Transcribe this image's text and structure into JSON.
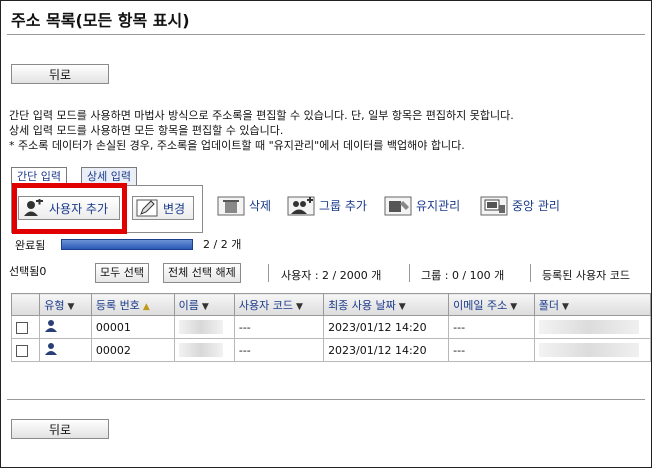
{
  "page": {
    "title": "주소 목록(모든 항목 표시)"
  },
  "nav": {
    "back_label": "뒤로"
  },
  "info": {
    "line1": "간단 입력 모드를 사용하면 마법사 방식으로 주소록을 편집할 수 있습니다. 단, 일부 항목은 편집하지 못합니다.",
    "line2": "상세 입력 모드를 사용하면 모든 항목을 편집할 수 있습니다.",
    "line3": "* 주소록 데이터가 손실된 경우, 주소록을 업데이트할 때 \"유지관리\"에서 데이터를 백업해야 합니다."
  },
  "tabs": [
    {
      "label": "간단 입력"
    },
    {
      "label": "상세 입력"
    }
  ],
  "toolbar": {
    "add_user": "사용자 추가",
    "edit": "변경",
    "delete": "삭제",
    "add_group": "그룹 추가",
    "maintenance": "유지관리",
    "central_management": "중앙 관리"
  },
  "progress": {
    "label": "완료됨",
    "text": "2 / 2 개",
    "fraction": 1.0
  },
  "selection": {
    "selected_label": "선택됨0",
    "select_all": "모두 선택",
    "clear_all": "전체 선택 해제",
    "user_count": "사용자 : 2 / 2000 개",
    "group_count": "그룹 : 0 / 100 개",
    "registered_user_code": "등록된 사용자 코드"
  },
  "table": {
    "headers": [
      "유형",
      "등록 번호",
      "이름",
      "사용자 코드",
      "최종 사용 날짜",
      "이메일 주소",
      "폴더"
    ],
    "rows": [
      {
        "reg_no": "00001",
        "user_code": "---",
        "last_used": "2023/01/12 14:20",
        "email": "---"
      },
      {
        "reg_no": "00002",
        "user_code": "---",
        "last_used": "2023/01/12 14:20",
        "email": "---"
      }
    ]
  },
  "colors": {
    "link": "#1a3a8a",
    "highlight": "#e00000",
    "progress": "#2b5bb8"
  }
}
